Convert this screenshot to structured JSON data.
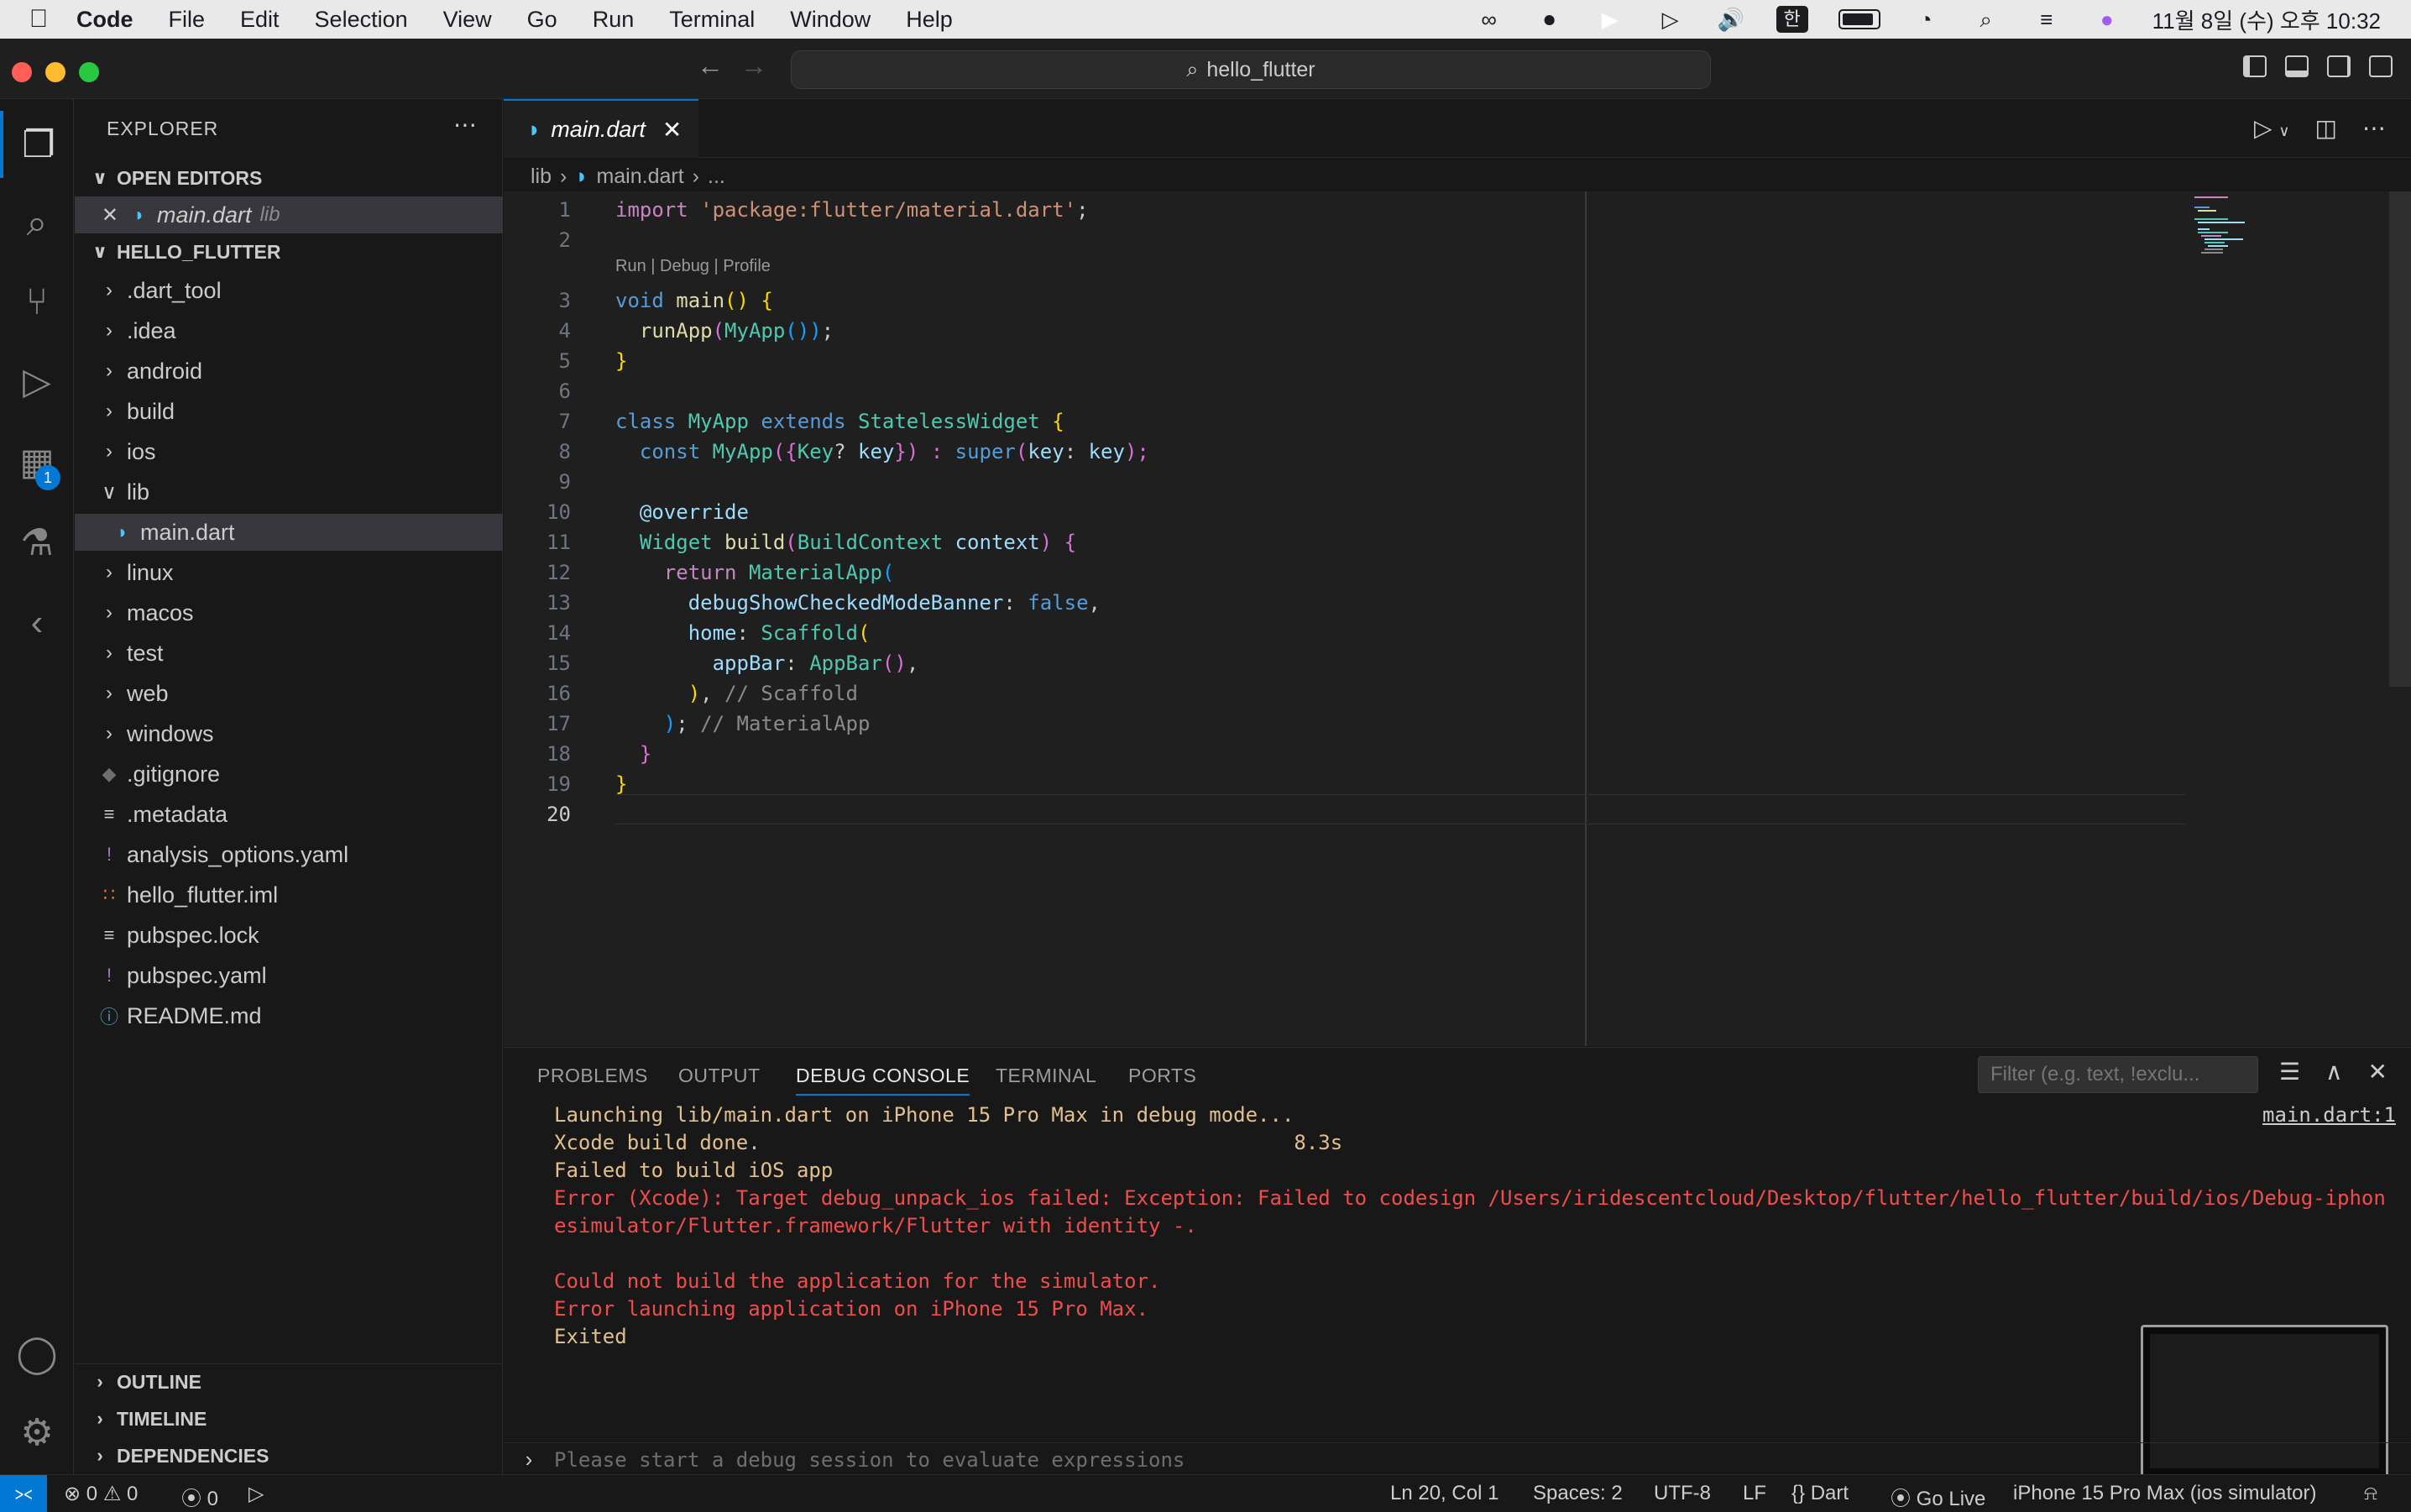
{
  "menubar": {
    "app": "Code",
    "items": [
      "File",
      "Edit",
      "Selection",
      "View",
      "Go",
      "Run",
      "Terminal",
      "Window",
      "Help"
    ],
    "input_source": "한",
    "clock": "11월 8일 (수) 오후 10:32"
  },
  "titlebar": {
    "search_text": "hello_flutter"
  },
  "activity": {
    "extensions_badge": "1"
  },
  "sidebar": {
    "title": "EXPLORER",
    "open_editors_label": "OPEN EDITORS",
    "open_editor_file": "main.dart",
    "open_editor_dir": "lib",
    "project_label": "HELLO_FLUTTER",
    "tree": [
      {
        "name": ".dart_tool",
        "type": "folder"
      },
      {
        "name": ".idea",
        "type": "folder"
      },
      {
        "name": "android",
        "type": "folder"
      },
      {
        "name": "build",
        "type": "folder"
      },
      {
        "name": "ios",
        "type": "folder"
      },
      {
        "name": "lib",
        "type": "folder-open"
      },
      {
        "name": "main.dart",
        "type": "dart"
      },
      {
        "name": "linux",
        "type": "folder"
      },
      {
        "name": "macos",
        "type": "folder"
      },
      {
        "name": "test",
        "type": "folder"
      },
      {
        "name": "web",
        "type": "folder"
      },
      {
        "name": "windows",
        "type": "folder"
      },
      {
        "name": ".gitignore",
        "type": "git"
      },
      {
        "name": ".metadata",
        "type": "lines"
      },
      {
        "name": "analysis_options.yaml",
        "type": "yaml"
      },
      {
        "name": "hello_flutter.iml",
        "type": "rss"
      },
      {
        "name": "pubspec.lock",
        "type": "lines"
      },
      {
        "name": "pubspec.yaml",
        "type": "yaml"
      },
      {
        "name": "README.md",
        "type": "info"
      }
    ],
    "outline_label": "OUTLINE",
    "timeline_label": "TIMELINE",
    "dependencies_label": "DEPENDENCIES"
  },
  "editor": {
    "tab_label": "main.dart",
    "breadcrumb": [
      "lib",
      "main.dart",
      "..."
    ],
    "codelens": "Run | Debug | Profile",
    "line_numbers": [
      "1",
      "2",
      "3",
      "4",
      "5",
      "6",
      "7",
      "8",
      "9",
      "10",
      "11",
      "12",
      "13",
      "14",
      "15",
      "16",
      "17",
      "18",
      "19",
      "20"
    ],
    "code": {
      "l1a": "import ",
      "l1b": "'package:flutter/material.dart'",
      "l1c": ";",
      "l3a": "void ",
      "l3b": "main",
      "l3c": "() {",
      "l4a": "  runApp",
      "l4b": "(",
      "l4c": "MyApp",
      "l4d": "())",
      "l4e": ";",
      "l5": "}",
      "l7a": "class ",
      "l7b": "MyApp ",
      "l7c": "extends ",
      "l7d": "StatelessWidget ",
      "l7e": "{",
      "l8a": "  const ",
      "l8b": "MyApp",
      "l8c": "({",
      "l8d": "Key",
      "l8e": "? ",
      "l8f": "key",
      "l8g": "}) : ",
      "l8h": "super",
      "l8i": "(",
      "l8j": "key",
      "l8k": ": ",
      "l8l": "key",
      "l8m": ");",
      "l10": "  @override",
      "l11a": "  Widget ",
      "l11b": "build",
      "l11c": "(",
      "l11d": "BuildContext ",
      "l11e": "context",
      "l11f": ") {",
      "l12a": "    return ",
      "l12b": "MaterialApp",
      "l12c": "(",
      "l13a": "      debugShowCheckedModeBanner",
      "l13b": ": ",
      "l13c": "false",
      "l13d": ",",
      "l14a": "      home",
      "l14b": ": ",
      "l14c": "Scaffold",
      "l14d": "(",
      "l15a": "        appBar",
      "l15b": ": ",
      "l15c": "AppBar",
      "l15d": "()",
      "l15e": ",",
      "l16a": "      )",
      "l16b": ", ",
      "l16c": "// Scaffold",
      "l17a": "    )",
      "l17b": "; ",
      "l17c": "// MaterialApp",
      "l18": "  }",
      "l19": "}"
    }
  },
  "panel": {
    "tabs": [
      "PROBLEMS",
      "OUTPUT",
      "DEBUG CONSOLE",
      "TERMINAL",
      "PORTS"
    ],
    "filter_placeholder": "Filter (e.g. text, !exclu...",
    "source_link": "main.dart:1",
    "console": [
      {
        "text": "Launching lib/main.dart on iPhone 15 Pro Max in debug mode...",
        "kind": "out"
      },
      {
        "text": "Xcode build done.                                            8.3s",
        "kind": "out"
      },
      {
        "text": "Failed to build iOS app",
        "kind": "out"
      },
      {
        "text": "Error (Xcode): Target debug_unpack_ios failed: Exception: Failed to codesign /Users/iridescentcloud/Desktop/flutter/hello_flutter/build/ios/Debug-iphon",
        "kind": "err"
      },
      {
        "text": "esimulator/Flutter.framework/Flutter with identity -.",
        "kind": "err"
      },
      {
        "text": "",
        "kind": "out"
      },
      {
        "text": "Could not build the application for the simulator.",
        "kind": "err"
      },
      {
        "text": "Error launching application on iPhone 15 Pro Max.",
        "kind": "err"
      },
      {
        "text": "Exited",
        "kind": "out"
      }
    ],
    "repl_placeholder": "Please start a debug session to evaluate expressions"
  },
  "statusbar": {
    "errors": "0",
    "warnings": "0",
    "ports": "0",
    "position": "Ln 20, Col 1",
    "spaces": "Spaces: 2",
    "encoding": "UTF-8",
    "eol": "LF",
    "language": "Dart",
    "golive": "Go Live",
    "device": "iPhone 15 Pro Max (ios simulator)"
  },
  "colors": {
    "accent": "#0078d4",
    "error_text": "#f14c4c",
    "output_text": "#e2c08d"
  }
}
